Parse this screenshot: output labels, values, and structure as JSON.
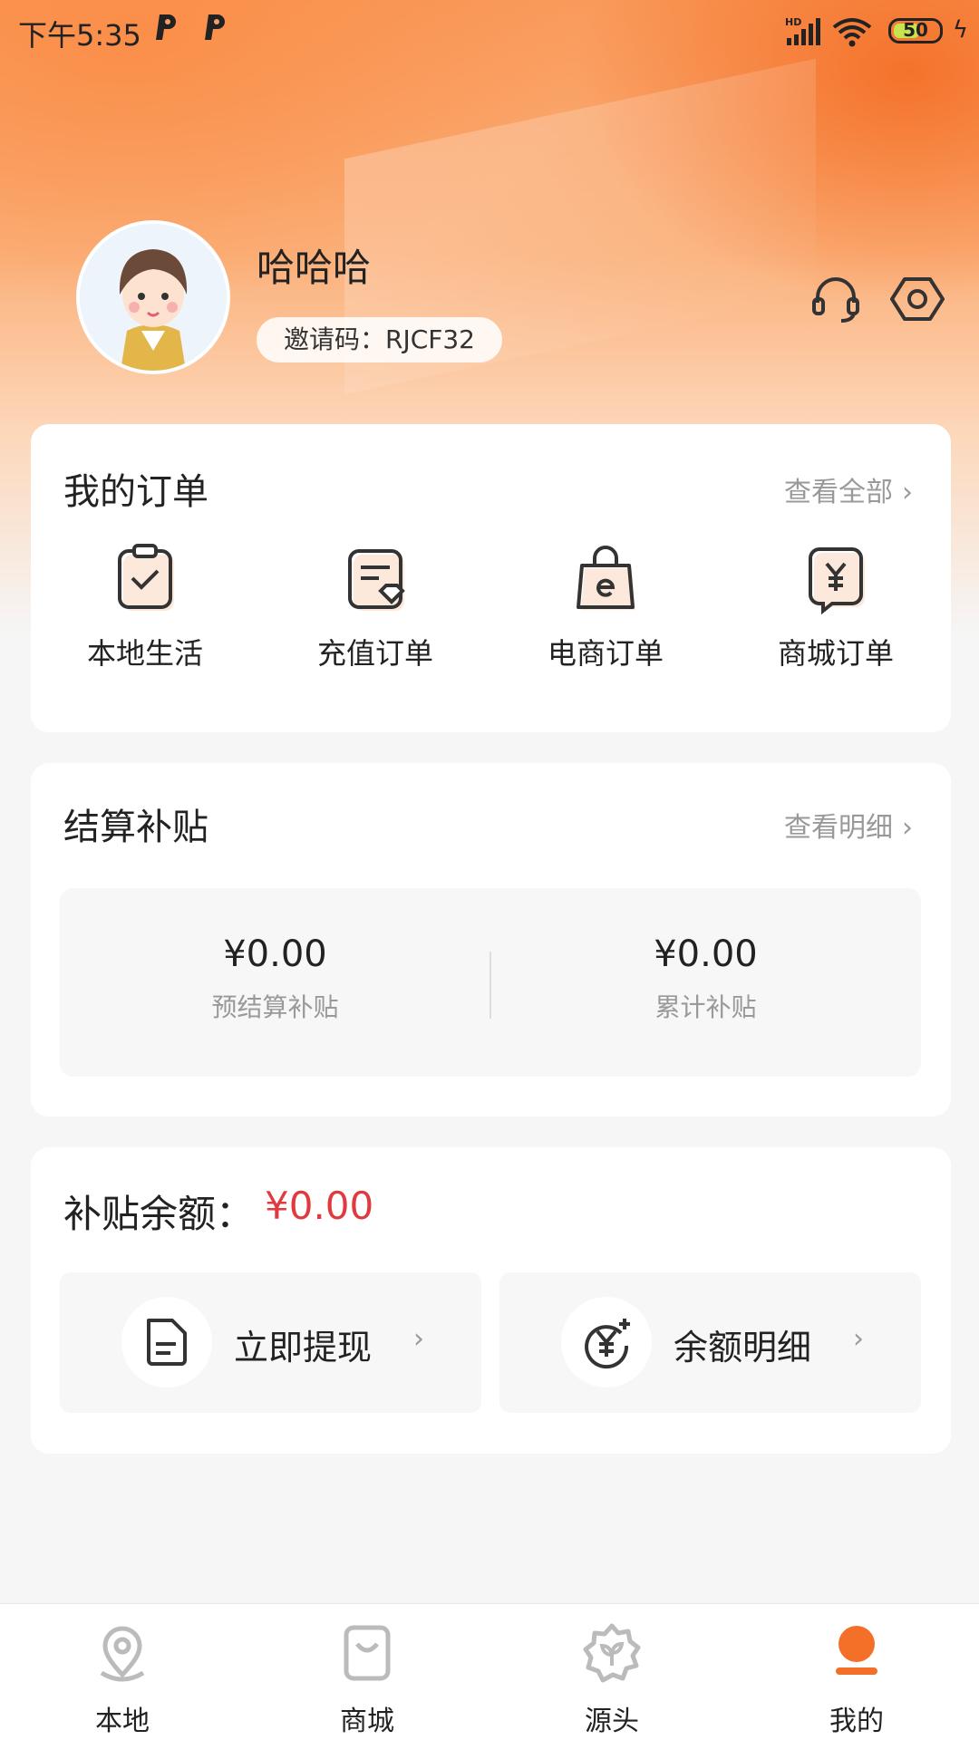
{
  "status_bar": {
    "time": "下午5:35",
    "network": "HD",
    "battery": "50"
  },
  "profile": {
    "username": "哈哈哈",
    "invite_code": "邀请码：RJCF32"
  },
  "orders": {
    "title": "我的订单",
    "view_all": "查看全部",
    "items": [
      {
        "label": "本地生活",
        "icon": "clipboard-check-icon"
      },
      {
        "label": "充值订单",
        "icon": "document-gem-icon"
      },
      {
        "label": "电商订单",
        "icon": "shopping-bag-icon"
      },
      {
        "label": "商城订单",
        "icon": "yuan-receipt-icon"
      }
    ]
  },
  "settlement": {
    "title": "结算补贴",
    "view_detail": "查看明细",
    "pre_amount": "¥0.00",
    "pre_label": "预结算补贴",
    "total_amount": "¥0.00",
    "total_label": "累计补贴"
  },
  "balance": {
    "label": "补贴余额：",
    "value": "¥0.00",
    "actions": [
      {
        "label": "立即提现",
        "icon": "withdraw-document-icon"
      },
      {
        "label": "余额明细",
        "icon": "yuan-plus-icon"
      }
    ]
  },
  "nav": [
    {
      "label": "本地",
      "icon": "location-pin-icon",
      "active": false
    },
    {
      "label": "商城",
      "icon": "shopping-bag-icon",
      "active": false
    },
    {
      "label": "源头",
      "icon": "sprout-badge-icon",
      "active": false
    },
    {
      "label": "我的",
      "icon": "user-icon",
      "active": true
    }
  ],
  "colors": {
    "accent": "#f47028",
    "price_red": "#e0393e"
  }
}
